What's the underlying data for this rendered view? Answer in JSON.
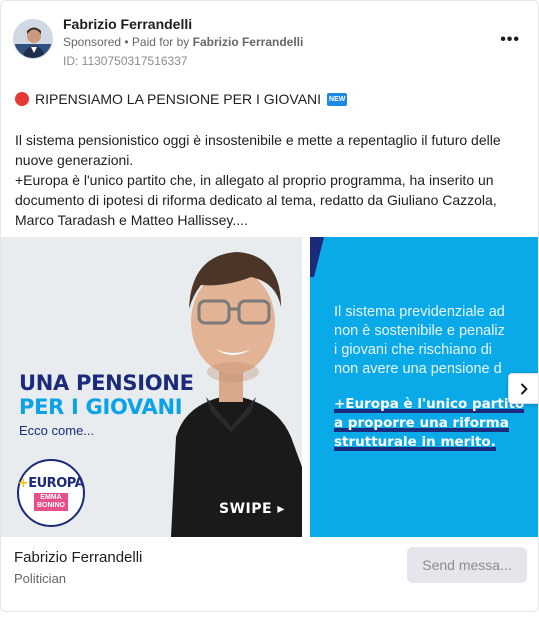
{
  "post": {
    "author": "Fabrizio Ferrandelli",
    "sponsored": "Sponsored",
    "paid_for_prefix": "• Paid for by",
    "paid_for_by": "Fabrizio Ferrandelli",
    "id_text": "ID: 1130750317516337",
    "more_icon": "•••",
    "headline": "RIPENSIAMO LA PENSIONE PER I GIOVANI",
    "new_badge": "NEW",
    "paragraph_1": "Il sistema pensionistico oggi è insostenibile e mette a repentaglio il futuro delle nuove generazioni.",
    "paragraph_2": "+Europa è l'unico partito che, in allegato al proprio programma, ha inserito un documento di ipotesi di riforma dedicato al tema, redatto da Giuliano Cazzola, Marco Taradash e Matteo Hallissey...."
  },
  "carousel": {
    "slide1": {
      "title_line1": "UNA PENSIONE",
      "title_line2": "PER I GIOVANI",
      "subtitle": "Ecco come...",
      "logo_plus": "+",
      "logo_text": "EUROPA",
      "logo_sub_1": "EMMA",
      "logo_sub_2": "BONINO",
      "swipe": "SWIPE ▸"
    },
    "slide2": {
      "line1": "Il sistema previdenziale ad",
      "line2": "non è sostenibile e penaliz",
      "line3": "i giovani che rischiano di",
      "line4": "non avere una pensione d",
      "strong1": "+Europa è l'unico partito",
      "strong2": "a proporre una riforma",
      "strong3": "strutturale in merito."
    }
  },
  "footer": {
    "page_name": "Fabrizio Ferrandelli",
    "category": "Politician",
    "button": "Send messa..."
  },
  "colors": {
    "accent_blue": "#0aa9e8",
    "brand_navy": "#1b2a7a",
    "headline_dot": "#e53935"
  }
}
